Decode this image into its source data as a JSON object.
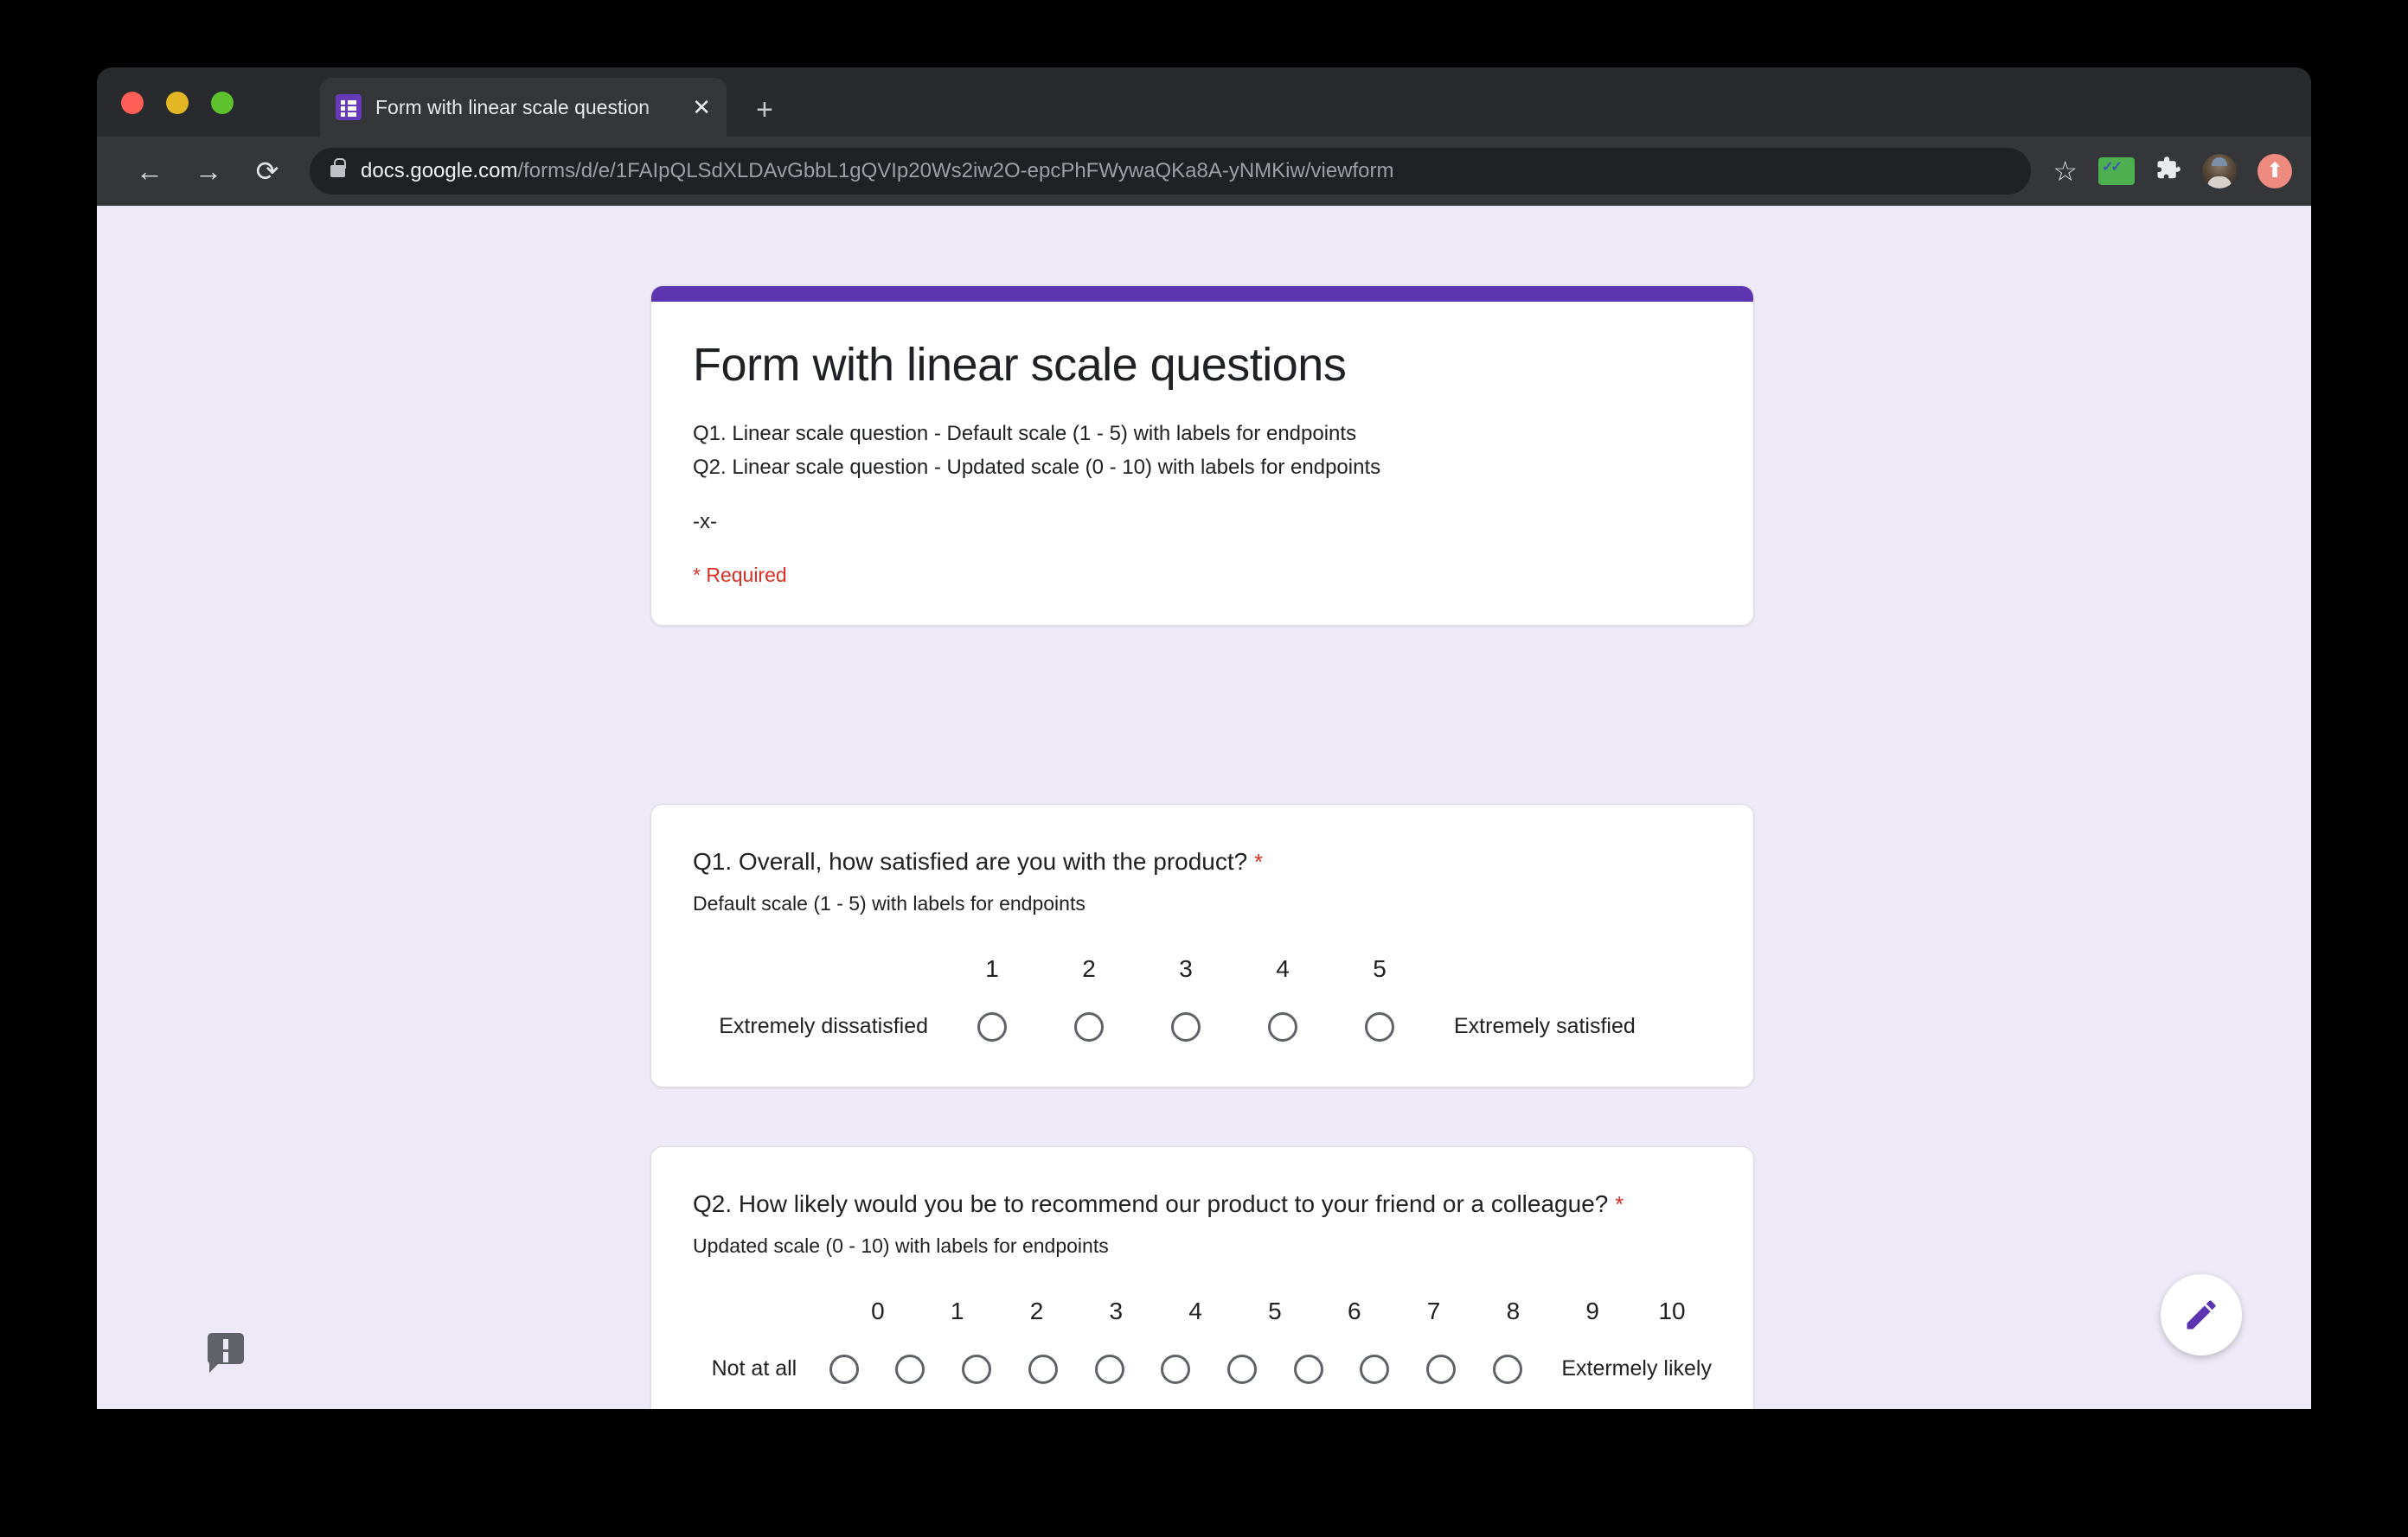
{
  "browser": {
    "tab": {
      "title": "Form with linear scale question",
      "close_label": "✕",
      "favicon": "google-forms-icon"
    },
    "new_tab_label": "+",
    "nav": {
      "back_label": "←",
      "forward_label": "→",
      "reload_label": "⟳"
    },
    "omnibox": {
      "host": "docs.google.com",
      "path": "/forms/d/e/1FAIpQLSdXLDAvGbbL1gQVIp20Ws2iw2O-epcPhFWywaQKa8A-yNMKiw/viewform",
      "lock": "lock-icon"
    },
    "toolbar": {
      "star_label": "☆",
      "mail_label": "mail-extension-icon",
      "puzzle_label": "🧩",
      "avatar_label": "profile-avatar",
      "update_label": "⬆"
    }
  },
  "form": {
    "accent_color": "#5E35B1",
    "title": "Form with linear scale questions",
    "description_line1": "Q1. Linear scale question - Default scale (1 - 5) with labels for endpoints",
    "description_line2": "Q2. Linear scale question - Updated scale (0 - 10) with labels for endpoints",
    "description_line3": "-x-",
    "required_note": "* Required",
    "required_marker": "*",
    "questions": [
      {
        "title": "Q1. Overall, how satisfied are you with the product?",
        "required": true,
        "description": "Default scale (1 - 5) with labels for endpoints",
        "scale": [
          "1",
          "2",
          "3",
          "4",
          "5"
        ],
        "low_label": "Extremely dissatisfied",
        "high_label": "Extremely satisfied",
        "selected": null
      },
      {
        "title": "Q2. How likely would you be to recommend our product to your friend or a colleague?",
        "required": true,
        "description": "Updated scale (0 - 10) with labels for endpoints",
        "scale": [
          "0",
          "1",
          "2",
          "3",
          "4",
          "5",
          "6",
          "7",
          "8",
          "9",
          "10"
        ],
        "low_label": "Not at all",
        "high_label": "Extermely likely",
        "selected": null
      }
    ]
  },
  "floating": {
    "feedback_label": "report-problem-icon",
    "edit_label": "edit-pencil-icon",
    "edit_color": "#5E35B1"
  }
}
